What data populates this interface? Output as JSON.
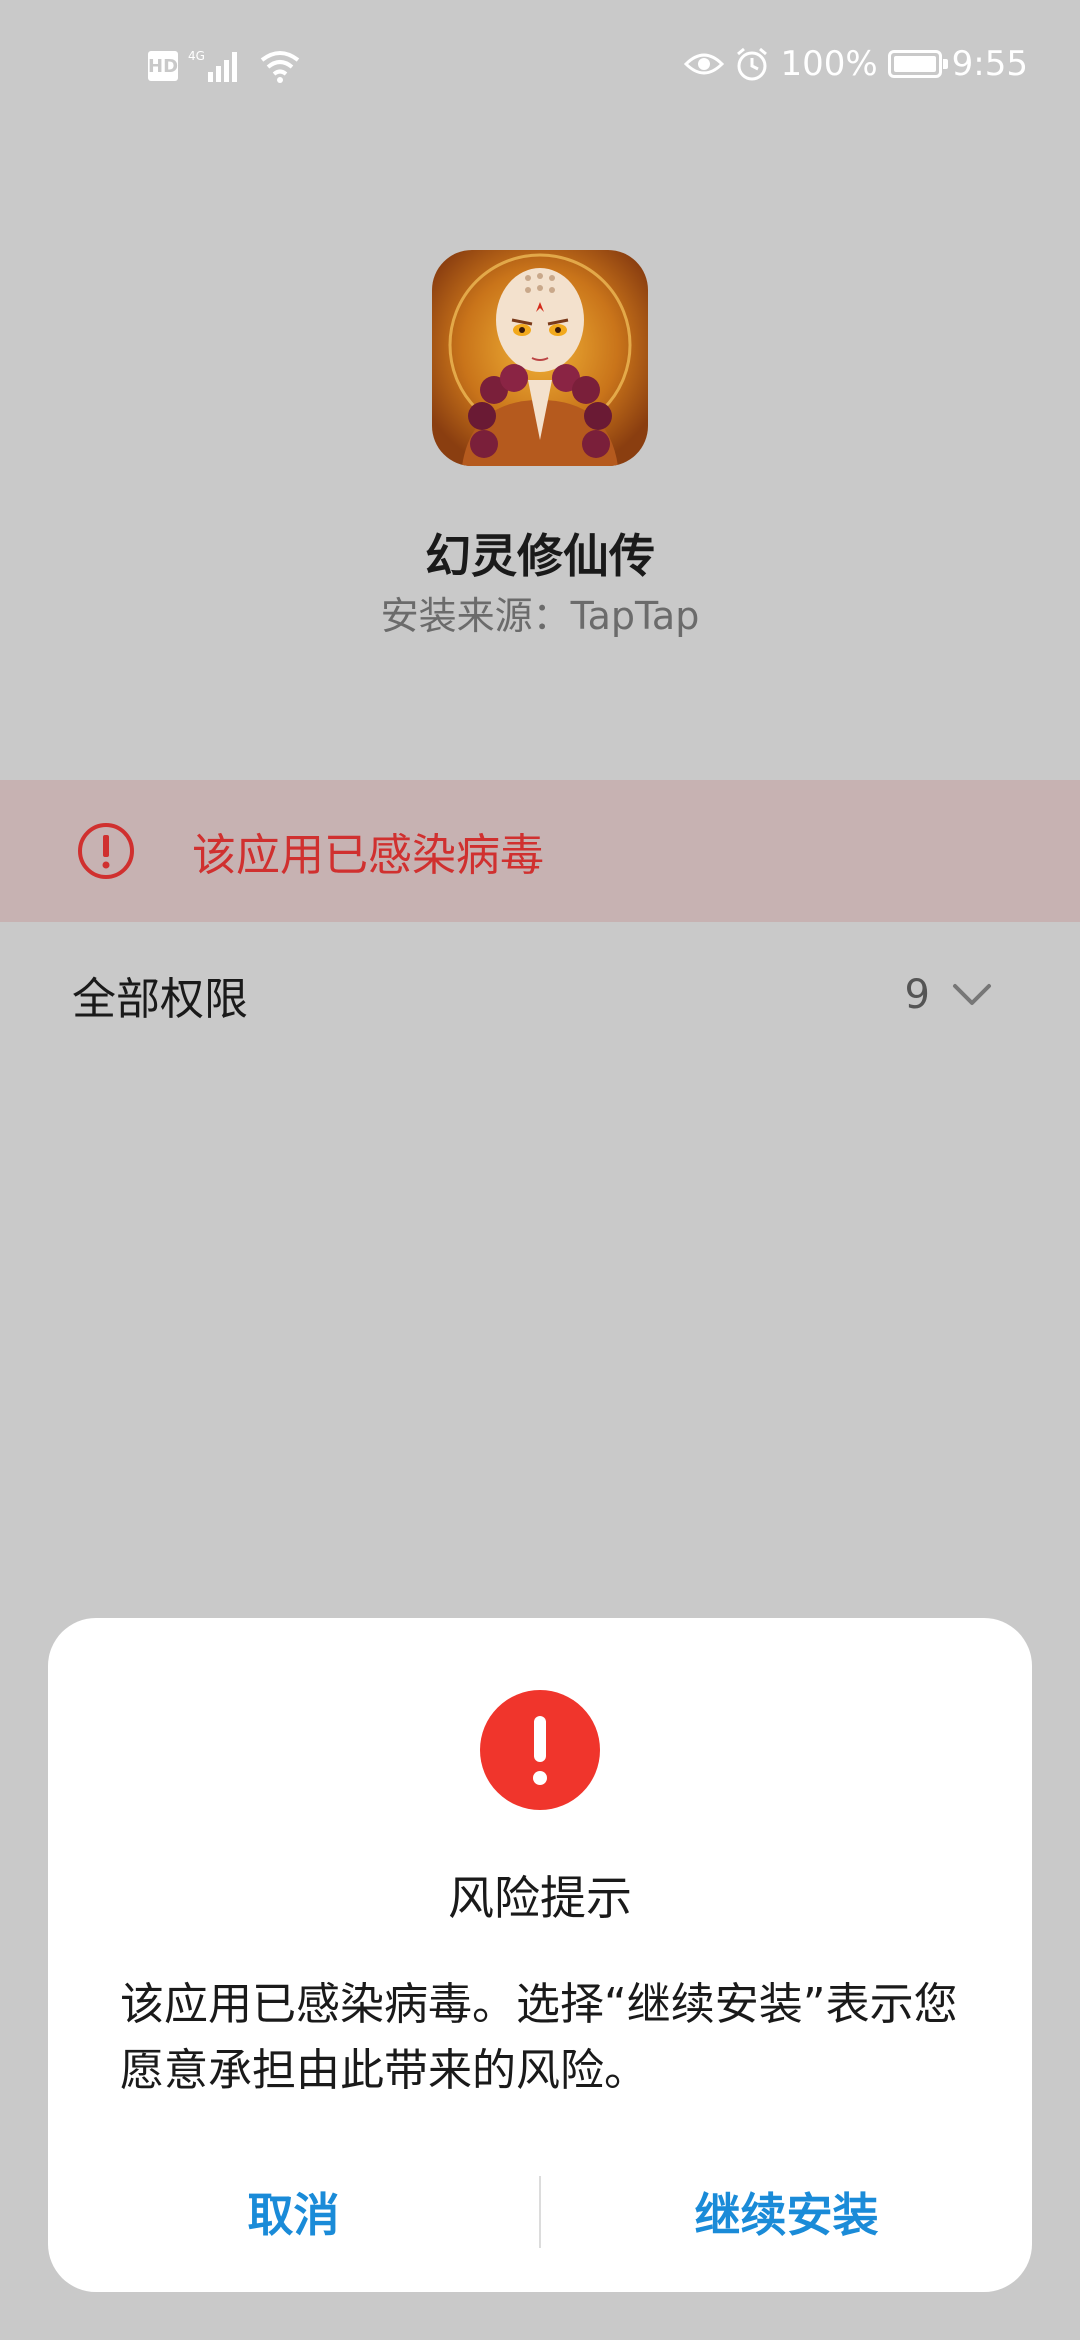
{
  "status_bar": {
    "hd_label": "HD",
    "network_label": "4G",
    "battery_percent": "100%",
    "time": "9:55"
  },
  "app": {
    "name": "幻灵修仙传",
    "source": "安装来源：TapTap",
    "icon": "app-icon-monk-character"
  },
  "warning": {
    "text": "该应用已感染病毒",
    "icon": "exclamation-circle-icon",
    "color": "#d0302f"
  },
  "permissions": {
    "label": "全部权限",
    "count": "9",
    "icon": "chevron-down-icon"
  },
  "dialog": {
    "icon": "alert-icon",
    "icon_color": "#f0352c",
    "title": "风险提示",
    "message": "该应用已感染病毒。选择“继续安装”表示您愿意承担由此带来的风险。",
    "cancel_label": "取消",
    "continue_label": "继续安装",
    "button_color": "#1a8bd8"
  }
}
